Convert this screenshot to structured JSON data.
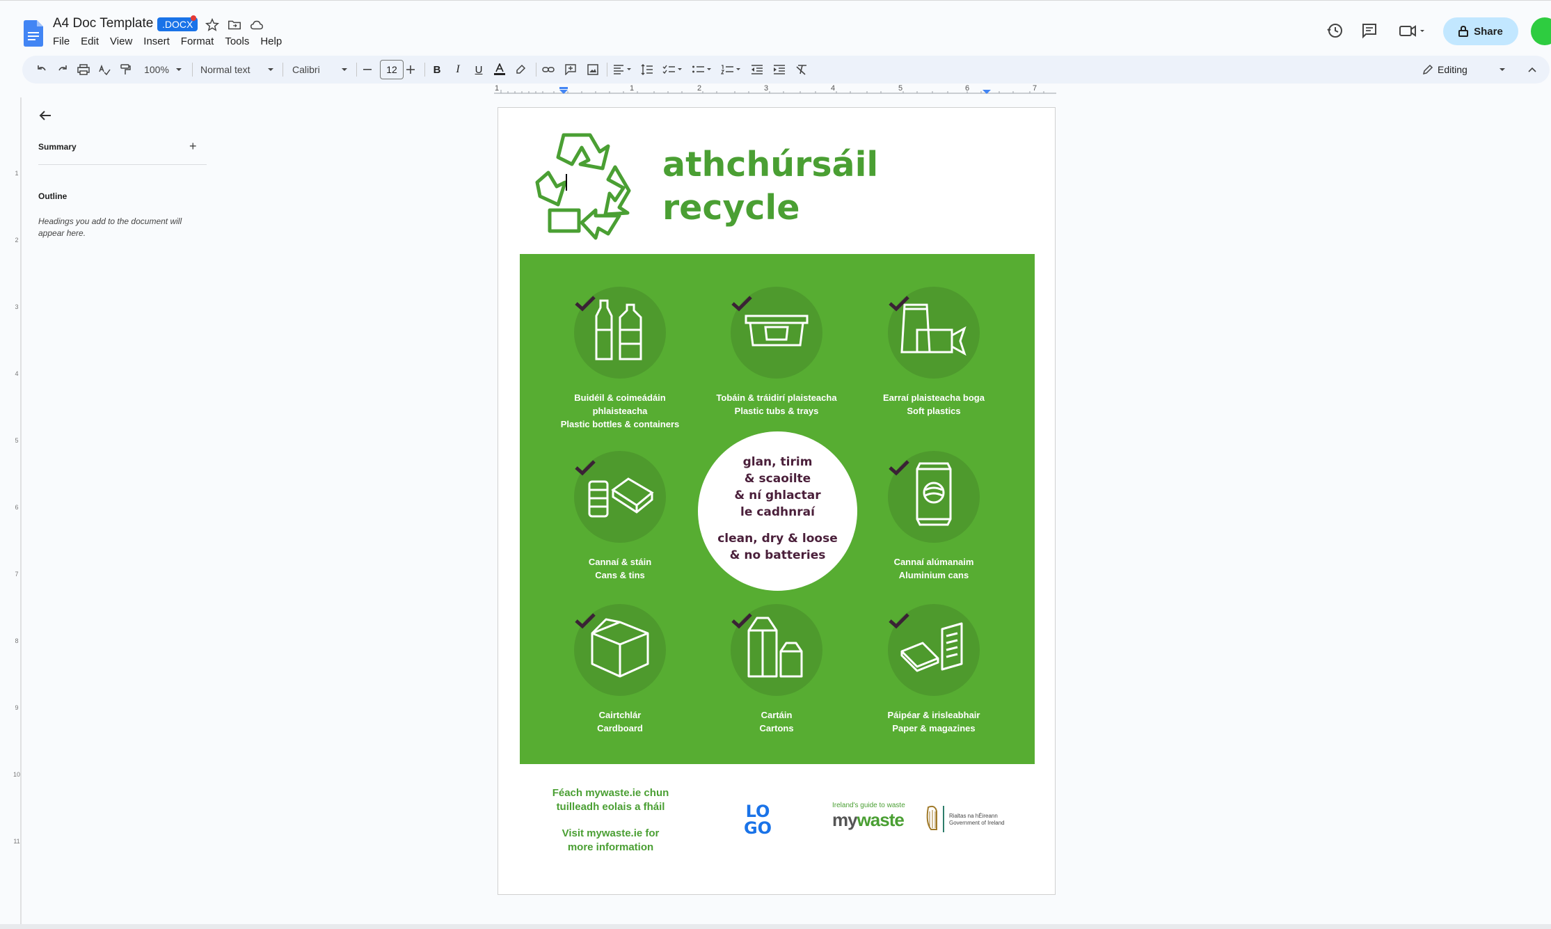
{
  "app": {
    "doc_title": "A4 Doc Template",
    "file_badge": ".DOCX",
    "menu": [
      "File",
      "Edit",
      "View",
      "Insert",
      "Format",
      "Tools",
      "Help"
    ],
    "share_label": "Share",
    "accent_color": "#1a73e8"
  },
  "toolbar": {
    "zoom": "100%",
    "style": "Normal text",
    "font": "Calibri",
    "font_size": "12",
    "mode": "Editing",
    "icons": [
      "undo-icon",
      "redo-icon",
      "print-icon",
      "spellcheck-icon",
      "paint-format-icon",
      "bold-icon",
      "italic-icon",
      "underline-icon",
      "text-color-icon",
      "highlight-icon",
      "link-icon",
      "comment-icon",
      "image-icon",
      "align-icon",
      "line-spacing-icon",
      "checklist-icon",
      "bullet-list-icon",
      "numbered-list-icon",
      "indent-decrease-icon",
      "indent-increase-icon",
      "clear-format-icon"
    ]
  },
  "ruler": {
    "marks": [
      "1",
      "1",
      "2",
      "3",
      "4",
      "5",
      "6",
      "7"
    ]
  },
  "vruler": {
    "marks": [
      "1",
      "2",
      "3",
      "4",
      "5",
      "6",
      "7",
      "8",
      "9",
      "10",
      "11"
    ]
  },
  "sidebar": {
    "summary_label": "Summary",
    "outline_label": "Outline",
    "outline_hint": "Headings you add to the document will appear here."
  },
  "poster": {
    "heading_line1": "athchúrsáil",
    "heading_line2": "recycle",
    "panel_color": "#57ad32",
    "items": [
      {
        "irish": "Buidéil & coimeádáin phlaisteacha",
        "english": "Plastic bottles & containers"
      },
      {
        "irish": "Tobáin & tráidirí plaisteacha",
        "english": "Plastic tubs & trays"
      },
      {
        "irish": "Earraí plaisteacha boga",
        "english": "Soft plastics"
      },
      {
        "irish": "Cannaí & stáin",
        "english": "Cans & tins"
      },
      {
        "irish": "Cannaí alúmanaim",
        "english": "Aluminium cans"
      },
      {
        "irish": "Cairtchlár",
        "english": "Cardboard"
      },
      {
        "irish": "Cartáin",
        "english": "Cartons"
      },
      {
        "irish": "Páipéar & irisleabhair",
        "english": "Paper & magazines"
      }
    ],
    "center_irish": [
      "glan, tirim",
      "& scaoilte",
      "& ní ghlactar",
      "le cadhnraí"
    ],
    "center_english": [
      "clean, dry & loose",
      "& no batteries"
    ],
    "footer_irish": [
      "Féach mywaste.ie chun",
      "tuilleadh eolais a fháil"
    ],
    "footer_english": [
      "Visit mywaste.ie for",
      "more information"
    ],
    "logo_text": [
      "LO",
      "GO"
    ],
    "mywaste_tagline": "Ireland's guide to waste",
    "mywaste_brand": [
      "my",
      "waste"
    ],
    "gov_text": [
      "Rialtas na hÉireann",
      "Government of Ireland"
    ]
  }
}
